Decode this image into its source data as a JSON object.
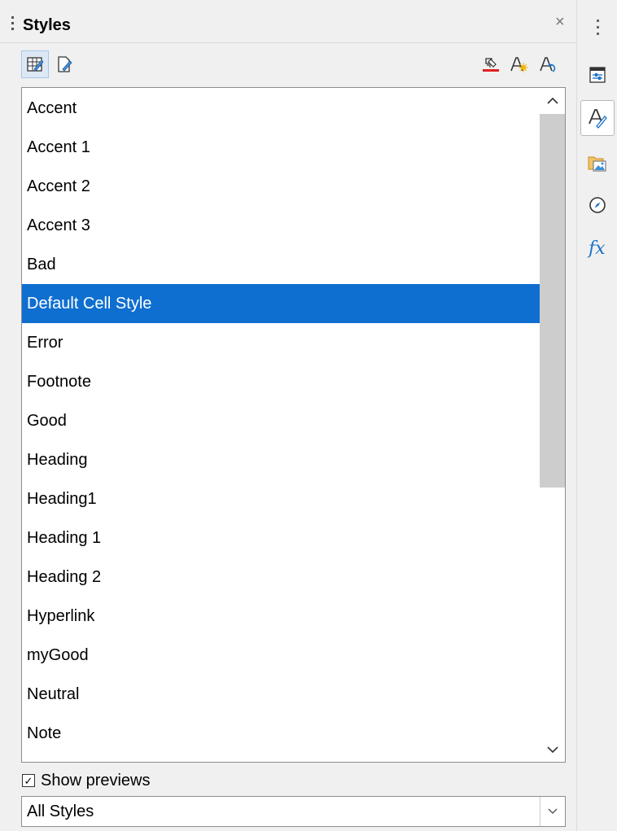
{
  "panel": {
    "title": "Styles"
  },
  "toolbar": {
    "left_icons": [
      "cell-styles-icon",
      "page-styles-icon"
    ],
    "right_icons": [
      "fill-format-mode-icon",
      "new-style-from-selection-icon",
      "update-style-icon"
    ]
  },
  "styles_list": {
    "items": [
      "Accent",
      "Accent 1",
      "Accent 2",
      "Accent 3",
      "Bad",
      "Default Cell Style",
      "Error",
      "Footnote",
      "Good",
      "Heading",
      "Heading1",
      "Heading 1",
      "Heading 2",
      "Hyperlink",
      "myGood",
      "Neutral",
      "Note"
    ],
    "selected": "Default Cell Style",
    "scroll": {
      "position": 0.0,
      "visible_fraction": 0.6
    }
  },
  "show_previews": {
    "label": "Show previews",
    "checked": true,
    "check_glyph": "✓"
  },
  "filter": {
    "value": "All Styles"
  },
  "deck": {
    "icons": [
      "properties-icon",
      "styles-icon",
      "gallery-icon",
      "navigator-icon",
      "functions-icon"
    ],
    "active": "styles-icon"
  },
  "colors": {
    "selection": "#0f6fd0",
    "accent_blue": "#1a73c8",
    "scroll_thumb": "#cdcdcd"
  }
}
